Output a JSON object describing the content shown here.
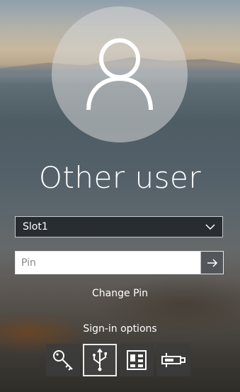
{
  "user": {
    "name": "Other user"
  },
  "slot": {
    "selected": "Slot1"
  },
  "pin": {
    "placeholder": "Pin",
    "value": ""
  },
  "links": {
    "change_pin": "Change Pin",
    "sign_in_options": "Sign-in options"
  },
  "sign_in_options": [
    {
      "icon": "key-icon",
      "selected": false
    },
    {
      "icon": "usb-icon",
      "selected": true
    },
    {
      "icon": "smart-card-reader-icon",
      "selected": false
    },
    {
      "icon": "security-key-icon",
      "selected": false
    }
  ]
}
